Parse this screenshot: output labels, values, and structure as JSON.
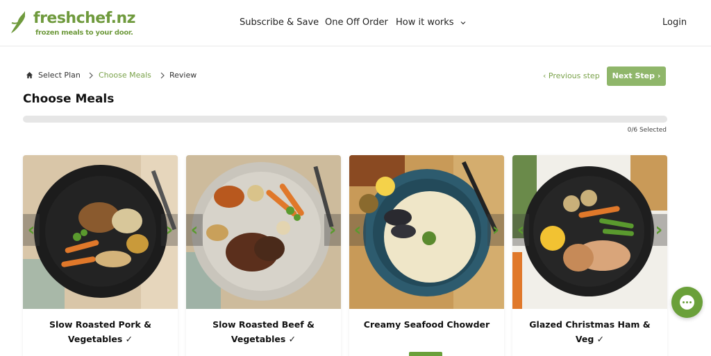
{
  "brand": {
    "name": "freshchef.nz",
    "tagline": "frozen meals to your door."
  },
  "nav": {
    "items": [
      "Subscribe & Save",
      "One Off Order",
      "How it works"
    ],
    "login": "Login"
  },
  "breadcrumb": {
    "items": [
      "Select Plan",
      "Choose Meals",
      "Review"
    ],
    "active_index": 1
  },
  "steps": {
    "previous": "‹ Previous step",
    "next": "Next Step ›"
  },
  "page": {
    "title": "Choose Meals",
    "selected_label": "0/6 Selected",
    "progress_fraction": 0
  },
  "meals": [
    {
      "title": "Slow Roasted Pork & Vegetables ✓",
      "image": "roast-pork-plate"
    },
    {
      "title": "Slow Roasted Beef & Vegetables ✓",
      "image": "roast-beef-plate"
    },
    {
      "title": "Creamy Seafood Chowder",
      "image": "seafood-chowder-bowl"
    },
    {
      "title": "Glazed Christmas Ham & Veg ✓",
      "image": "christmas-ham-plate"
    }
  ],
  "colors": {
    "brand_green": "#6f9a3d",
    "button_green": "#8fb66a",
    "accent_green": "#7aa24a"
  }
}
